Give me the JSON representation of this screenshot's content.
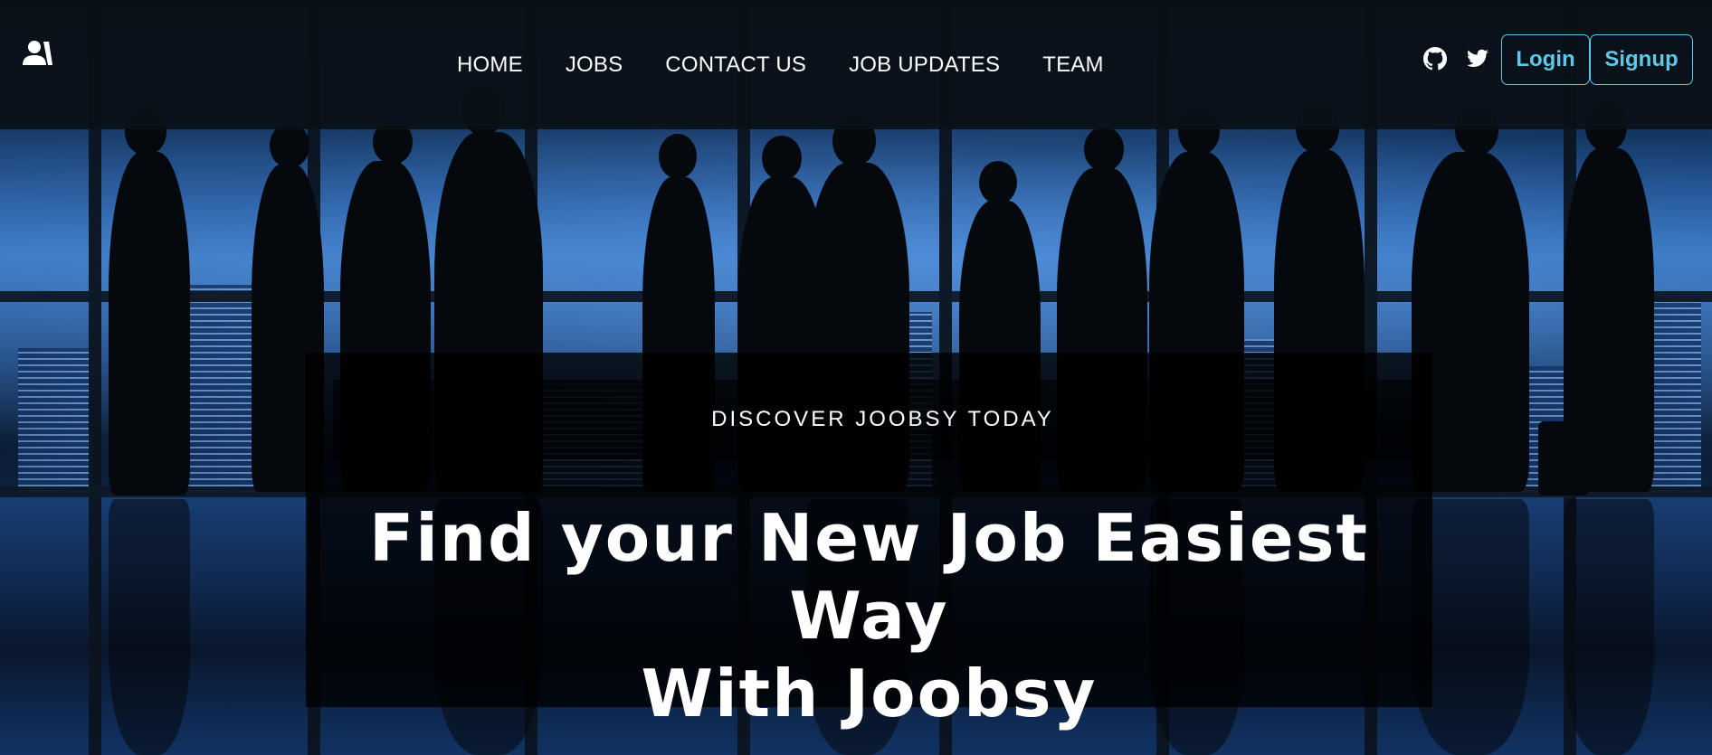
{
  "nav": {
    "links": [
      {
        "label": "HOME"
      },
      {
        "label": "JOBS"
      },
      {
        "label": "CONTACT US"
      },
      {
        "label": "JOB UPDATES"
      },
      {
        "label": "TEAM"
      }
    ],
    "social": [
      {
        "icon": "github-icon"
      },
      {
        "icon": "twitter-icon"
      }
    ],
    "login_label": "Login",
    "signup_label": "Signup",
    "logo_icon": "user-logo-icon"
  },
  "hero": {
    "subtitle": "DISCOVER JOOBSY TODAY",
    "title_line1": "Find your New Job Easiest Way",
    "title_line2": "With Joobsy"
  },
  "colors": {
    "accent": "#5ec8e8",
    "navbar_bg": "#0a1118",
    "text": "#ffffff"
  }
}
